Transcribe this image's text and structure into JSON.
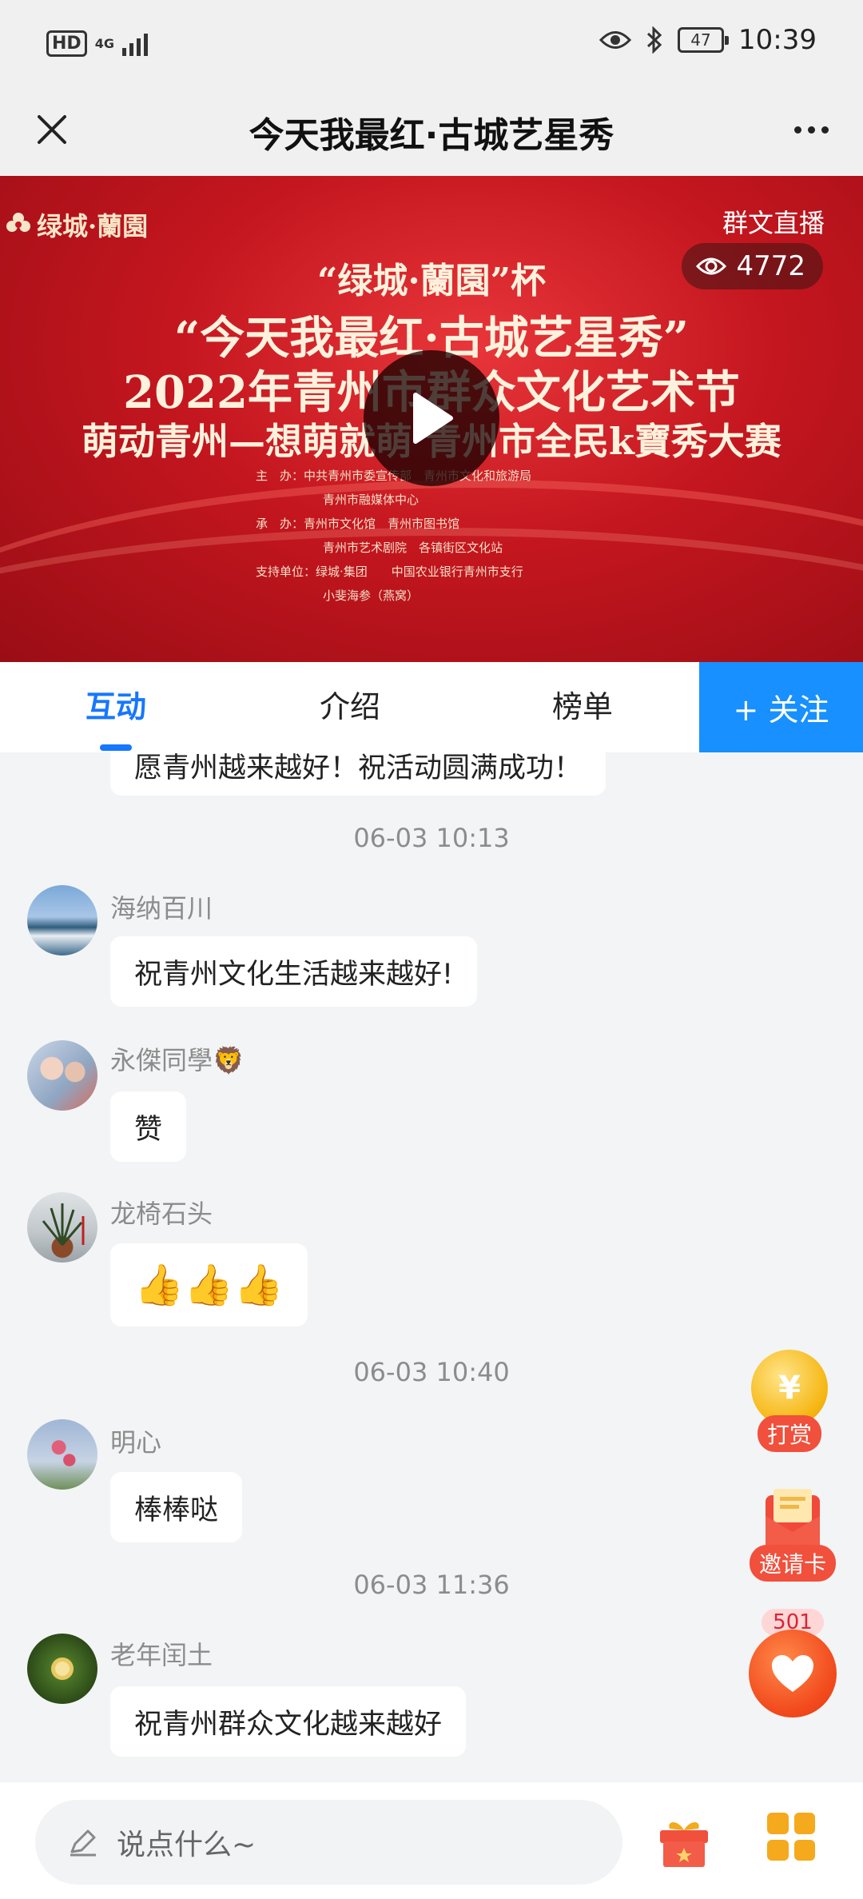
{
  "status_bar": {
    "hd": "HD",
    "network": "4G",
    "battery": "47",
    "time": "10:39"
  },
  "title_bar": {
    "title": "今天我最红·古城艺星秀"
  },
  "video": {
    "brand_logo": "绿城·蘭園",
    "channel": "群文直播",
    "viewer_count": "4772",
    "poster_line1": "“绿城·蘭園”杯",
    "poster_line2": "“今天我最红·古城艺星秀”",
    "poster_line3": "2022年青州市群众文化艺术节",
    "poster_line4": "萌动青州—想萌就萌 青州市全民k寶秀大赛",
    "credits": [
      "主　办：中共青州市委宣传部　青州市文化和旅游局",
      "青州市融媒体中心",
      "承　办：青州市文化馆　青州市图书馆",
      "青州市艺术剧院　各镇街区文化站",
      "支持单位：绿城·集团　　中国农业银行青州市支行",
      "小斐海参（燕窝）"
    ]
  },
  "tabs": [
    {
      "label": "互动"
    },
    {
      "label": "介绍"
    },
    {
      "label": "榜单"
    }
  ],
  "follow_label": "+ 关注",
  "chat": {
    "partial_message": "愿青州越来越好！祝活动圆满成功！",
    "timestamps": [
      "06-03 10:13",
      "06-03 10:40",
      "06-03 11:36"
    ],
    "messages": [
      {
        "user": "海纳百川",
        "text": "祝青州文化生活越来越好!"
      },
      {
        "user": "永傑同學🦁",
        "text": "赞"
      },
      {
        "user": "龙椅石头",
        "text": "👍👍👍"
      },
      {
        "user": "明心",
        "text": "棒棒哒"
      },
      {
        "user": "老年闰土",
        "text": "祝青州群众文化越来越好"
      }
    ]
  },
  "floating": {
    "reward_label": "打赏",
    "invite_label": "邀请卡",
    "like_count": "501"
  },
  "bottom_bar": {
    "placeholder": "说点什么~"
  },
  "colors": {
    "accent": "#1677ff",
    "follow_bg": "#1890ff",
    "poster_red": "#c4161f",
    "reward_orange": "#f0503c"
  }
}
